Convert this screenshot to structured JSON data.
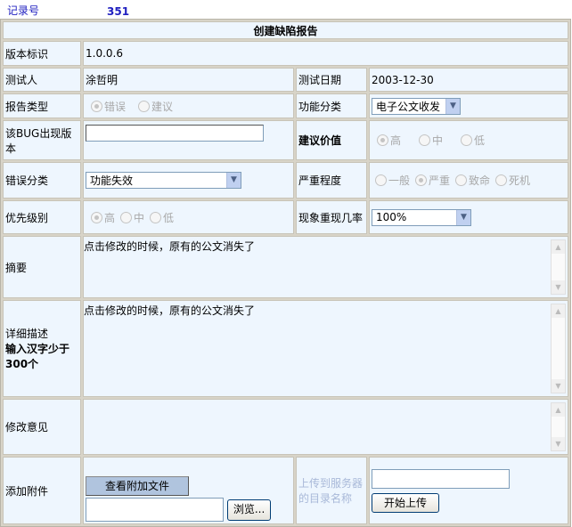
{
  "record": {
    "label": "记录号",
    "value": "351"
  },
  "title": "创建缺陷报告",
  "version": {
    "label": "版本标识",
    "value": "1.0.0.6"
  },
  "tester": {
    "label": "测试人",
    "value": "涂哲明",
    "date_label": "测试日期",
    "date": "2003-12-30"
  },
  "report_type": {
    "label": "报告类型",
    "options": [
      "错误",
      "建议"
    ],
    "selected": "错误"
  },
  "func_cat": {
    "label": "功能分类",
    "value": "电子公文收发"
  },
  "bug_version": {
    "label": "该BUG出现版本",
    "value": ""
  },
  "suggest_value": {
    "label": "建议价值",
    "options": [
      "高",
      "中",
      "低"
    ],
    "selected": "高"
  },
  "error_cat": {
    "label": "错误分类",
    "value": "功能失效"
  },
  "severity": {
    "label": "严重程度",
    "options": [
      "一般",
      "严重",
      "致命",
      "死机"
    ],
    "selected": "严重"
  },
  "priority": {
    "label": "优先级别",
    "options": [
      "高",
      "中",
      "低"
    ],
    "selected": "高"
  },
  "reproduce": {
    "label": "现象重现几率",
    "value": "100%"
  },
  "summary": {
    "label": "摘要",
    "value": "点击修改的时候，原有的公文消失了"
  },
  "detail": {
    "label": "详细描述",
    "hint": "输入汉字少于300个",
    "value": "点击修改的时候，原有的公文消失了"
  },
  "modify": {
    "label": "修改意见",
    "value": ""
  },
  "attach": {
    "label": "添加附件",
    "view_button": "查看附加文件",
    "browse_button": "浏览...",
    "upload_dir_label": "上传到服务器的目录名称",
    "upload_button": "开始上传"
  }
}
